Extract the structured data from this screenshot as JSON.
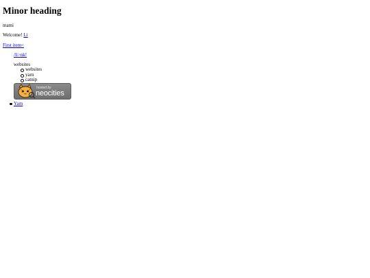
{
  "heading": "Minor heading",
  "text_line": "mami",
  "welcome": {
    "text": "Welcome! ",
    "link_label": "Li"
  },
  "first_item_link": "First item<",
  "escaped_link": "/li>nk!",
  "websites_label": "websites",
  "sublist": [
    "websites",
    "yarn",
    "catnip"
  ],
  "badge": {
    "top_text": "hosted by",
    "brand": "neocities",
    "icon": "neocities-cat-icon"
  },
  "bottom_link": "Yarn",
  "colors": {
    "link": "#0000ee",
    "text": "#000000",
    "badge_bg": "#7a7a7a"
  }
}
